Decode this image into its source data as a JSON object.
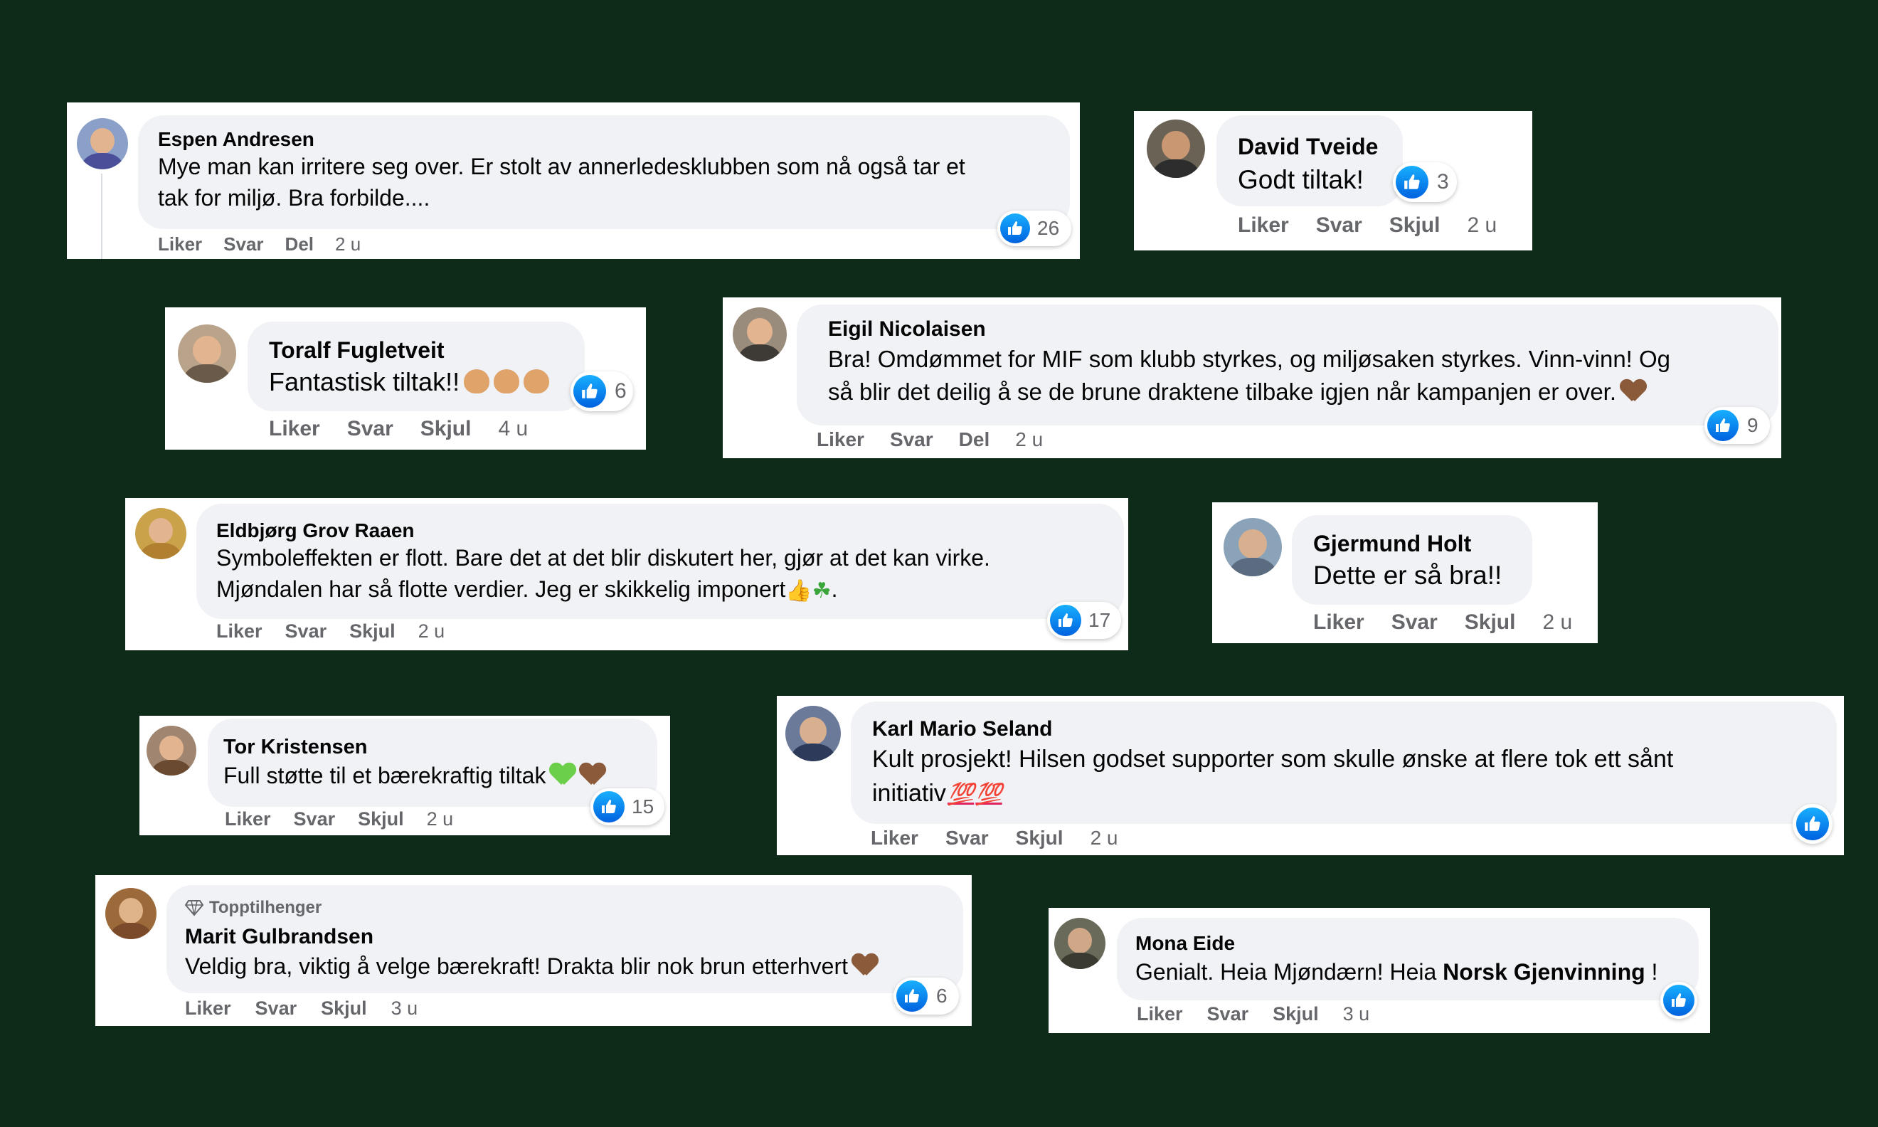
{
  "colors": {
    "background": "#0d2b18",
    "card": "#ffffff",
    "bubble": "#f0f2f5",
    "like_blue": "#1877f2",
    "meta_gray": "#65676b"
  },
  "comments": [
    {
      "name": "Espen Andresen",
      "lines": [
        "Mye man kan irritere seg over. Er stolt av annerledesklubben som nå også tar et",
        "tak for miljø. Bra forbilde...."
      ],
      "actions": [
        "Liker",
        "Svar",
        "Del"
      ],
      "time": "2 u",
      "likes": "26"
    },
    {
      "name": "David Tveide",
      "lines": [
        "Godt tiltak!"
      ],
      "actions": [
        "Liker",
        "Svar",
        "Skjul"
      ],
      "time": "2 u",
      "likes": "3"
    },
    {
      "name": "Toralf Fugletveit",
      "lines": [
        "Fantastisk tiltak!!"
      ],
      "emoji": "clapping-hands x3",
      "actions": [
        "Liker",
        "Svar",
        "Skjul"
      ],
      "time": "4 u",
      "likes": "6"
    },
    {
      "name": "Eigil Nicolaisen",
      "lines": [
        "Bra! Omdømmet for MIF som klubb styrkes, og miljøsaken styrkes. Vinn-vinn! Og",
        "så blir det deilig å se de brune draktene tilbake igjen når kampanjen er over."
      ],
      "emoji": "brown-heart",
      "actions": [
        "Liker",
        "Svar",
        "Del"
      ],
      "time": "2 u",
      "likes": "9"
    },
    {
      "name": "Eldbjørg Grov Raaen",
      "lines": [
        "Symboleffekten er flott. Bare det at det blir diskutert her, gjør at det kan virke.",
        "Mjøndalen har så flotte verdier. Jeg er skikkelig imponert",
        "."
      ],
      "emoji": "thumbs-up, shamrock",
      "actions": [
        "Liker",
        "Svar",
        "Skjul"
      ],
      "time": "2 u",
      "likes": "17"
    },
    {
      "name": "Gjermund Holt",
      "lines": [
        "Dette er så bra!!"
      ],
      "actions": [
        "Liker",
        "Svar",
        "Skjul"
      ],
      "time": "2 u",
      "likes": ""
    },
    {
      "name": "Tor Kristensen",
      "lines": [
        "Full støtte til et bærekraftig tiltak"
      ],
      "emoji": "green-heart, brown-heart",
      "actions": [
        "Liker",
        "Svar",
        "Skjul"
      ],
      "time": "2 u",
      "likes": "15"
    },
    {
      "name": "Karl Mario Seland",
      "lines": [
        "Kult prosjekt! Hilsen godset supporter som skulle ønske at flere tok ett sånt",
        "initiativ"
      ],
      "emoji": "hundred-points x2",
      "hundred": "💯",
      "actions": [
        "Liker",
        "Svar",
        "Skjul"
      ],
      "time": "2 u",
      "likes": ""
    },
    {
      "name": "Marit Gulbrandsen",
      "badge": "Topptilhenger",
      "lines": [
        "Veldig bra, viktig å velge bærekraft! Drakta blir nok brun etterhvert"
      ],
      "emoji": "brown-heart",
      "actions": [
        "Liker",
        "Svar",
        "Skjul"
      ],
      "time": "3 u",
      "likes": "6"
    },
    {
      "name": "Mona Eide",
      "lines": [
        "Genialt. Heia Mjøndærn! Heia ",
        "Norsk Gjenvinning",
        " !"
      ],
      "actions": [
        "Liker",
        "Svar",
        "Skjul"
      ],
      "time": "3 u",
      "likes": ""
    }
  ]
}
